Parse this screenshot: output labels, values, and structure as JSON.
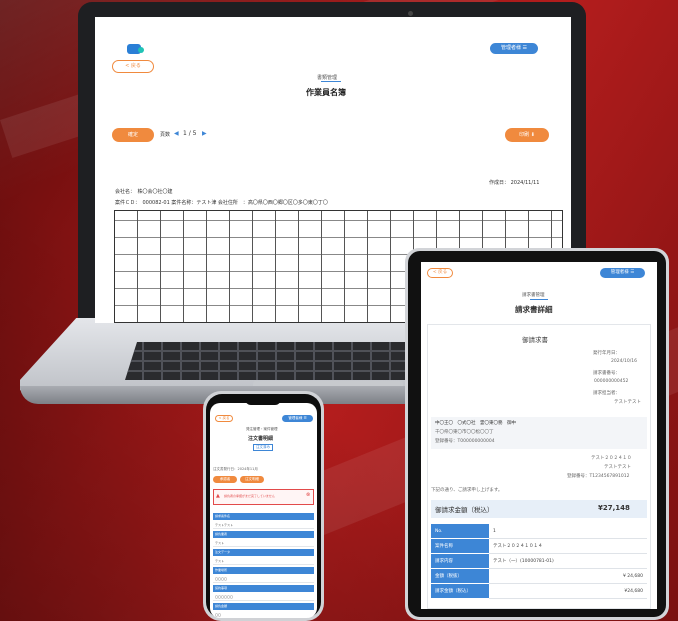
{
  "laptop": {
    "back_button": "< 戻る",
    "user_menu": "管理者様",
    "section_title": "書類管理",
    "title": "作業員名簿",
    "confirm_button": "確定",
    "page_label": "頁数",
    "page_indicator": "1 / 5",
    "print_button": "印刷",
    "created_date": "作成日： 2024/11/11",
    "company_line": "会社名：　株〇会〇社〇建",
    "case_line": "案件ＣＤ：　000082-01 案件名称：テスト津 会社住所　：高〇県〇西〇郷〇区〇多〇東〇丁〇"
  },
  "tablet": {
    "back_button": "< 戻る",
    "user_menu": "管理者様",
    "section_title": "請求書管理",
    "title": "請求書詳細",
    "doc_heading": "御請求書",
    "date_label": "発行年月日：",
    "date_value": "2024/10/16",
    "number_label": "請求書番号：",
    "number_value": "000000000452",
    "person_label": "請求担当者：",
    "person_value": "テストテスト",
    "client_name": "中〇王〇　〇式〇社　霊〇東〇務　御中",
    "client_addr": "千〇県〇東〇市〇〇松〇〇丁",
    "client_reg": "登録番号：T000000000004",
    "issuer_name": "テスト２０２４１０",
    "issuer_sub": "テストテスト",
    "issuer_reg": "登録番号：T1234567891012",
    "note": "下記の通り、ご請求申し上げます。",
    "total_label": "御請求金額（税込）",
    "total_value": "¥27,148",
    "table": [
      {
        "label": "No.",
        "value": "1"
      },
      {
        "label": "案件名称",
        "value": "テスト２０２４１０１４"
      },
      {
        "label": "請求内容",
        "value": "テスト（一）(10000781-01)"
      },
      {
        "label": "金額（税抜）",
        "value": "¥ 24,680"
      },
      {
        "label": "請求金額（税込）",
        "value": "¥24,680"
      }
    ]
  },
  "phone": {
    "back_button": "< 戻る",
    "user_menu": "管理者様",
    "section_title": "発注管理・案件管理",
    "title": "注文書明細",
    "status_badge": "注文済み",
    "date_line": "注文書発行日：2024年11月",
    "button1": "承認者",
    "button2": "注文明細",
    "alert": "請負者の承諾がまだ完了していません",
    "sections": [
      {
        "header": "請求案件名",
        "value": "テストテスト"
      },
      {
        "header": "請負業者",
        "value": "テスト"
      },
      {
        "header": "注文データ",
        "value": "テスト"
      },
      {
        "header": "作業場所",
        "value": "〇〇〇〇"
      },
      {
        "header": "契約事項",
        "value": "〇〇〇〇〇〇"
      },
      {
        "header": "請負金額",
        "value": "〇〇"
      }
    ]
  },
  "colors": {
    "accent_orange": "#f08a3e",
    "accent_blue": "#3d86d6",
    "background_red": "#9c1717"
  }
}
